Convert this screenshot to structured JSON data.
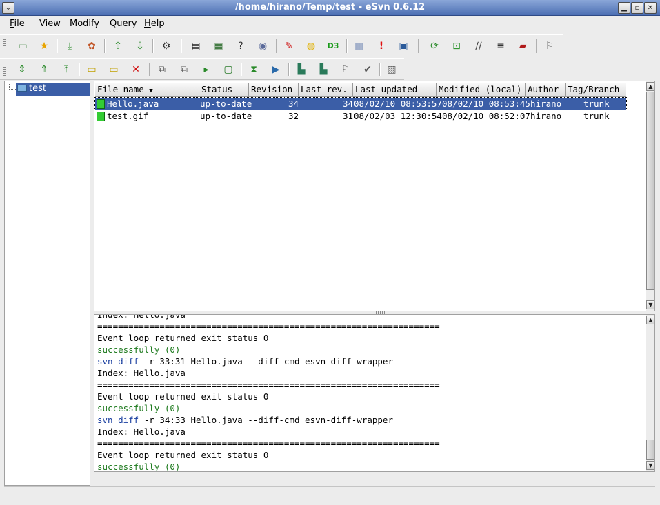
{
  "window": {
    "title": "/home/hirano/Temp/test - eSvn 0.6.12"
  },
  "menu": [
    {
      "label": "File",
      "u": "F",
      "rest": "ile"
    },
    {
      "label": "View",
      "u": "",
      "rest": "View"
    },
    {
      "label": "Modify",
      "u": "",
      "rest": "Modify"
    },
    {
      "label": "Query",
      "u": "",
      "rest": "Query"
    },
    {
      "label": "Help",
      "u": "H",
      "rest": "elp"
    }
  ],
  "toolbar1": {
    "icons": [
      "open-folder-icon",
      "favorite-star-icon",
      "checkout-icon",
      "colors-icon",
      "up-arrow-icon",
      "down-arrow-icon",
      "tree-icon",
      "copy-icon",
      "list-icon",
      "help-icon",
      "database-icon",
      "pin-icon",
      "bulb-icon",
      "d3-icon",
      "table-icon",
      "alert-icon",
      "monitor-icon",
      "refresh-icon",
      "green-refresh-icon",
      "tools-icon",
      "document-icon",
      "book-icon",
      "bookmark-icon"
    ],
    "d3_label": "D3"
  },
  "toolbar2": {
    "icons": [
      "update-icon",
      "commit-icon",
      "revert-icon",
      "new-folder-icon",
      "add-folder-icon",
      "delete-icon",
      "copy-file-icon",
      "move-file-icon",
      "forward-icon",
      "window-icon",
      "merge-icon",
      "import-icon",
      "log-icon",
      "blame-icon",
      "properties-icon",
      "edit-icon",
      "export-icon"
    ]
  },
  "tree": {
    "root": "test"
  },
  "filelist": {
    "columns": [
      "File name",
      "Status",
      "Revision",
      "Last rev.",
      "Last updated",
      "Modified (local)",
      "Author",
      "Tag/Branch"
    ],
    "rows": [
      {
        "name": "Hello.java",
        "status": "up-to-date",
        "revision": "34",
        "last_rev": "34",
        "last_updated": "08/02/10 08:53:57",
        "modified": "08/02/10 08:53:45",
        "author": "hirano",
        "tag": "trunk"
      },
      {
        "name": "test.gif",
        "status": "up-to-date",
        "revision": "32",
        "last_rev": "31",
        "last_updated": "08/02/03 12:30:54",
        "modified": "08/02/10 08:52:07",
        "author": "hirano",
        "tag": "trunk"
      }
    ]
  },
  "log": {
    "partial": "Index: Hello.java",
    "lines": [
      {
        "text": "==================================================================",
        "cls": ""
      },
      {
        "text": "Event loop returned exit status 0",
        "cls": ""
      },
      {
        "text": "successfully (0)",
        "cls": "green"
      },
      {
        "text": "svn diff -r 33:31 Hello.java --diff-cmd esvn-diff-wrapper",
        "cls": "cmd"
      },
      {
        "text": "Index: Hello.java",
        "cls": ""
      },
      {
        "text": "==================================================================",
        "cls": ""
      },
      {
        "text": "Event loop returned exit status 0",
        "cls": ""
      },
      {
        "text": "successfully (0)",
        "cls": "green"
      },
      {
        "text": "svn diff -r 34:33 Hello.java --diff-cmd esvn-diff-wrapper",
        "cls": "cmd"
      },
      {
        "text": "Index: Hello.java",
        "cls": ""
      },
      {
        "text": "==================================================================",
        "cls": ""
      },
      {
        "text": "Event loop returned exit status 0",
        "cls": ""
      },
      {
        "text": "successfully (0)",
        "cls": "green"
      }
    ]
  },
  "colors": {
    "selection": "#3b5ea7",
    "success": "#1e7a1e",
    "svn_keyword": "#1a3fa0"
  }
}
